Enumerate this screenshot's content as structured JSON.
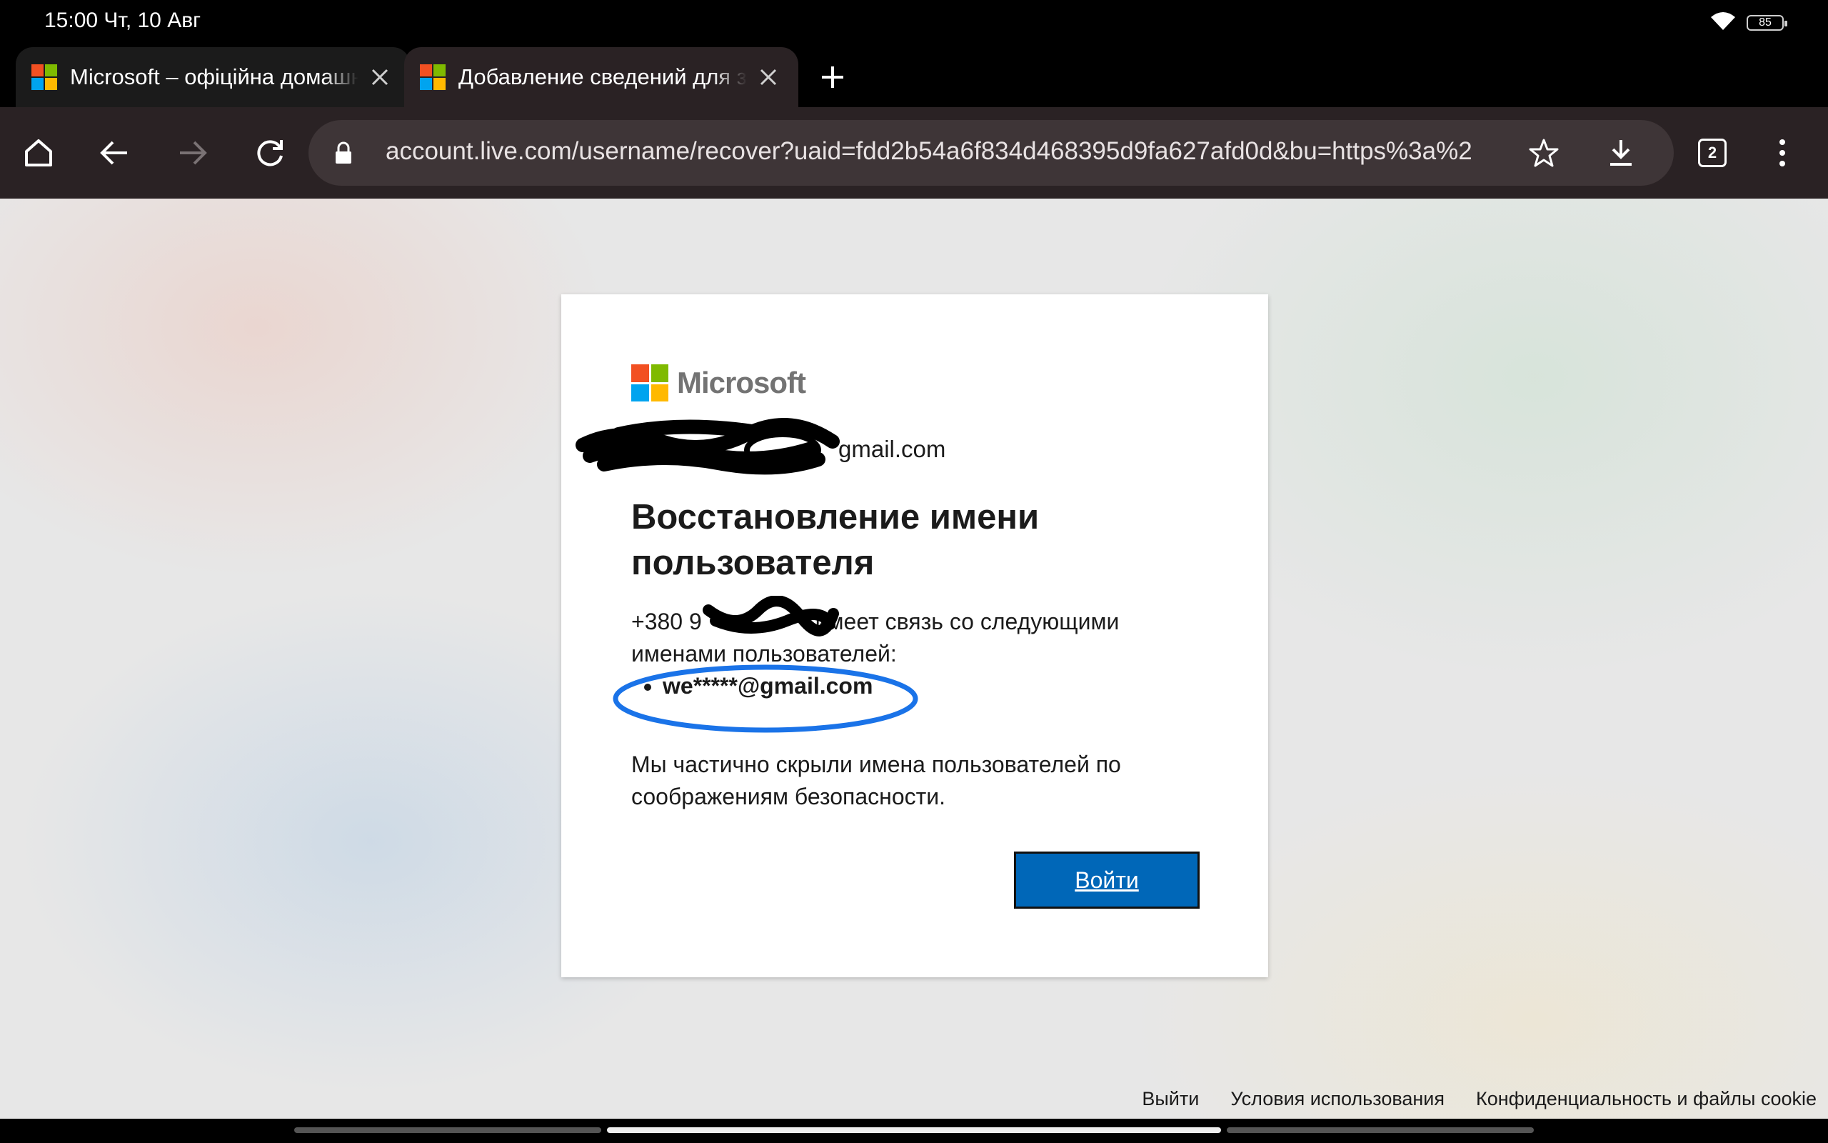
{
  "status_bar": {
    "time": "15:00 Чт, 10 Авг",
    "battery": "85"
  },
  "tabs": [
    {
      "title": "Microsoft – офіційна домашня сторінка",
      "favicon": "microsoft-logo-icon"
    },
    {
      "title": "Добавление сведений для защиты",
      "favicon": "microsoft-logo-icon"
    }
  ],
  "toolbar": {
    "url": "account.live.com/username/recover?uaid=fdd2b54a6f834d468395d9fa627afd0d&bu=https%3a%2",
    "tab_count": "2"
  },
  "card": {
    "brand": "Microsoft",
    "identity_suffix": "gmail.com",
    "heading": "Восстановление имени пользователя",
    "phone_prefix": "+380 9",
    "desc_rest": " имеет связь со следующими именами пользователей:",
    "usernames": [
      "we*****@gmail.com"
    ],
    "note": "Мы частично скрыли имена пользователей по соображениям безопасности.",
    "signin_label": "Войти"
  },
  "footer": {
    "links": [
      "Выйти",
      "Условия использования",
      "Конфиденциальность и файлы cookie"
    ]
  },
  "colors": {
    "accent": "#0067b8",
    "toolbar": "#2a2224",
    "annotation": "#1a73e8"
  }
}
